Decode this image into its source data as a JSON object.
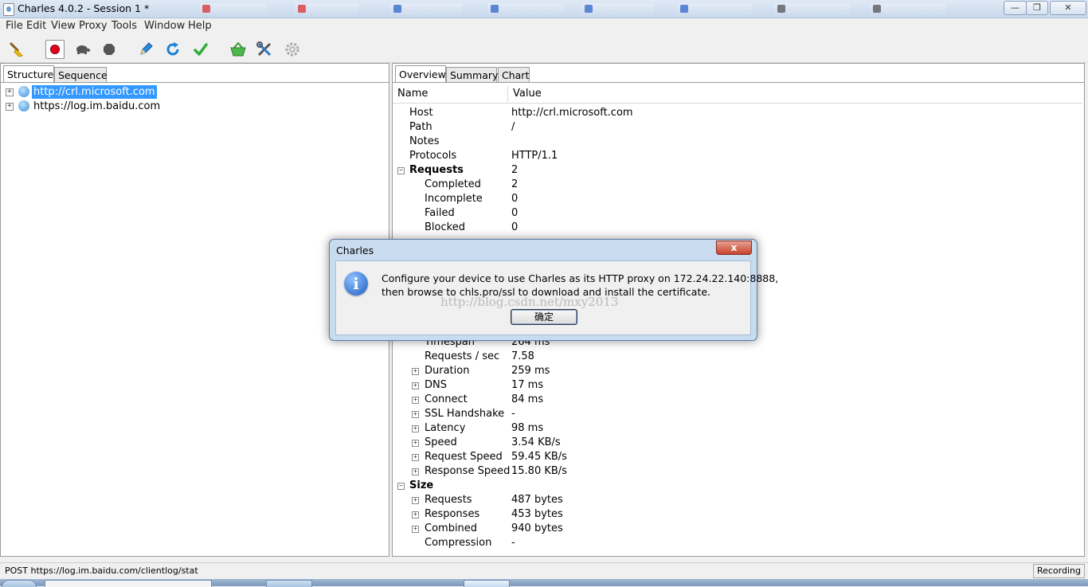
{
  "window": {
    "title": "Charles 4.0.2 - Session 1 *",
    "minimize": "—",
    "maximize": "❐",
    "close": "✕"
  },
  "menu": [
    "File",
    "Edit",
    "View",
    "Proxy",
    "Tools",
    "Window",
    "Help"
  ],
  "left_tabs": [
    "Structure",
    "Sequence"
  ],
  "tree": [
    {
      "label": "http://crl.microsoft.com",
      "selected": true
    },
    {
      "label": "https://log.im.baidu.com",
      "selected": false
    }
  ],
  "right_tabs": [
    "Overview",
    "Summary",
    "Chart"
  ],
  "overview": {
    "col_name": "Name",
    "col_value": "Value",
    "rows": [
      {
        "name": "Host",
        "value": "http://crl.microsoft.com",
        "indent": 0,
        "exp": "",
        "bold": false
      },
      {
        "name": "Path",
        "value": "/",
        "indent": 0,
        "exp": "",
        "bold": false
      },
      {
        "name": "Notes",
        "value": "",
        "indent": 0,
        "exp": "",
        "bold": false
      },
      {
        "name": "Protocols",
        "value": "HTTP/1.1",
        "indent": 0,
        "exp": "",
        "bold": false
      },
      {
        "name": "Requests",
        "value": "2",
        "indent": 0,
        "exp": "−",
        "bold": true
      },
      {
        "name": "Completed",
        "value": "2",
        "indent": 1,
        "exp": "",
        "bold": false
      },
      {
        "name": "Incomplete",
        "value": "0",
        "indent": 1,
        "exp": "",
        "bold": false
      },
      {
        "name": "Failed",
        "value": "0",
        "indent": 1,
        "exp": "",
        "bold": false
      },
      {
        "name": "Blocked",
        "value": "0",
        "indent": 1,
        "exp": "",
        "bold": false
      },
      {
        "name": "Timespan",
        "value": "264 ms",
        "indent": 1,
        "exp": "",
        "bold": false
      },
      {
        "name": "Requests / sec",
        "value": "7.58",
        "indent": 1,
        "exp": "",
        "bold": false
      },
      {
        "name": "Duration",
        "value": "259 ms",
        "indent": 1,
        "exp": "+",
        "bold": false
      },
      {
        "name": "DNS",
        "value": "17 ms",
        "indent": 1,
        "exp": "+",
        "bold": false
      },
      {
        "name": "Connect",
        "value": "84 ms",
        "indent": 1,
        "exp": "+",
        "bold": false
      },
      {
        "name": "SSL Handshake",
        "value": "-",
        "indent": 1,
        "exp": "+",
        "bold": false
      },
      {
        "name": "Latency",
        "value": "98 ms",
        "indent": 1,
        "exp": "+",
        "bold": false
      },
      {
        "name": "Speed",
        "value": "3.54 KB/s",
        "indent": 1,
        "exp": "+",
        "bold": false
      },
      {
        "name": "Request Speed",
        "value": "59.45 KB/s",
        "indent": 1,
        "exp": "+",
        "bold": false
      },
      {
        "name": "Response Speed",
        "value": "15.80 KB/s",
        "indent": 1,
        "exp": "+",
        "bold": false
      },
      {
        "name": "Size",
        "value": "",
        "indent": 0,
        "exp": "−",
        "bold": true
      },
      {
        "name": "Requests",
        "value": "487 bytes",
        "indent": 1,
        "exp": "+",
        "bold": false
      },
      {
        "name": "Responses",
        "value": "453 bytes",
        "indent": 1,
        "exp": "+",
        "bold": false
      },
      {
        "name": "Combined",
        "value": "940 bytes",
        "indent": 1,
        "exp": "+",
        "bold": false
      },
      {
        "name": "Compression",
        "value": "-",
        "indent": 1,
        "exp": "",
        "bold": false
      }
    ]
  },
  "dialog": {
    "title": "Charles",
    "close": "x",
    "line1": "Configure your device to use Charles as its HTTP proxy on 172.24.22.140:8888,",
    "line2": "then browse to chls.pro/ssl to download and install the certificate.",
    "ok": "确定",
    "icon_glyph": "i"
  },
  "watermark": "http://blog.csdn.net/mxy2013",
  "status": {
    "text": "POST https://log.im.baidu.com/clientlog/stat",
    "recording": "Recording"
  },
  "icons": [
    "broom-icon",
    "record-icon",
    "turtle-icon",
    "stop-icon",
    "pen-icon",
    "refresh-icon",
    "check-icon",
    "basket-icon",
    "tools-icon",
    "gear-icon"
  ],
  "colors": {
    "selection": "#3399ff",
    "dialog_frame": "#c9dbef",
    "close_red": "#c7432b"
  }
}
